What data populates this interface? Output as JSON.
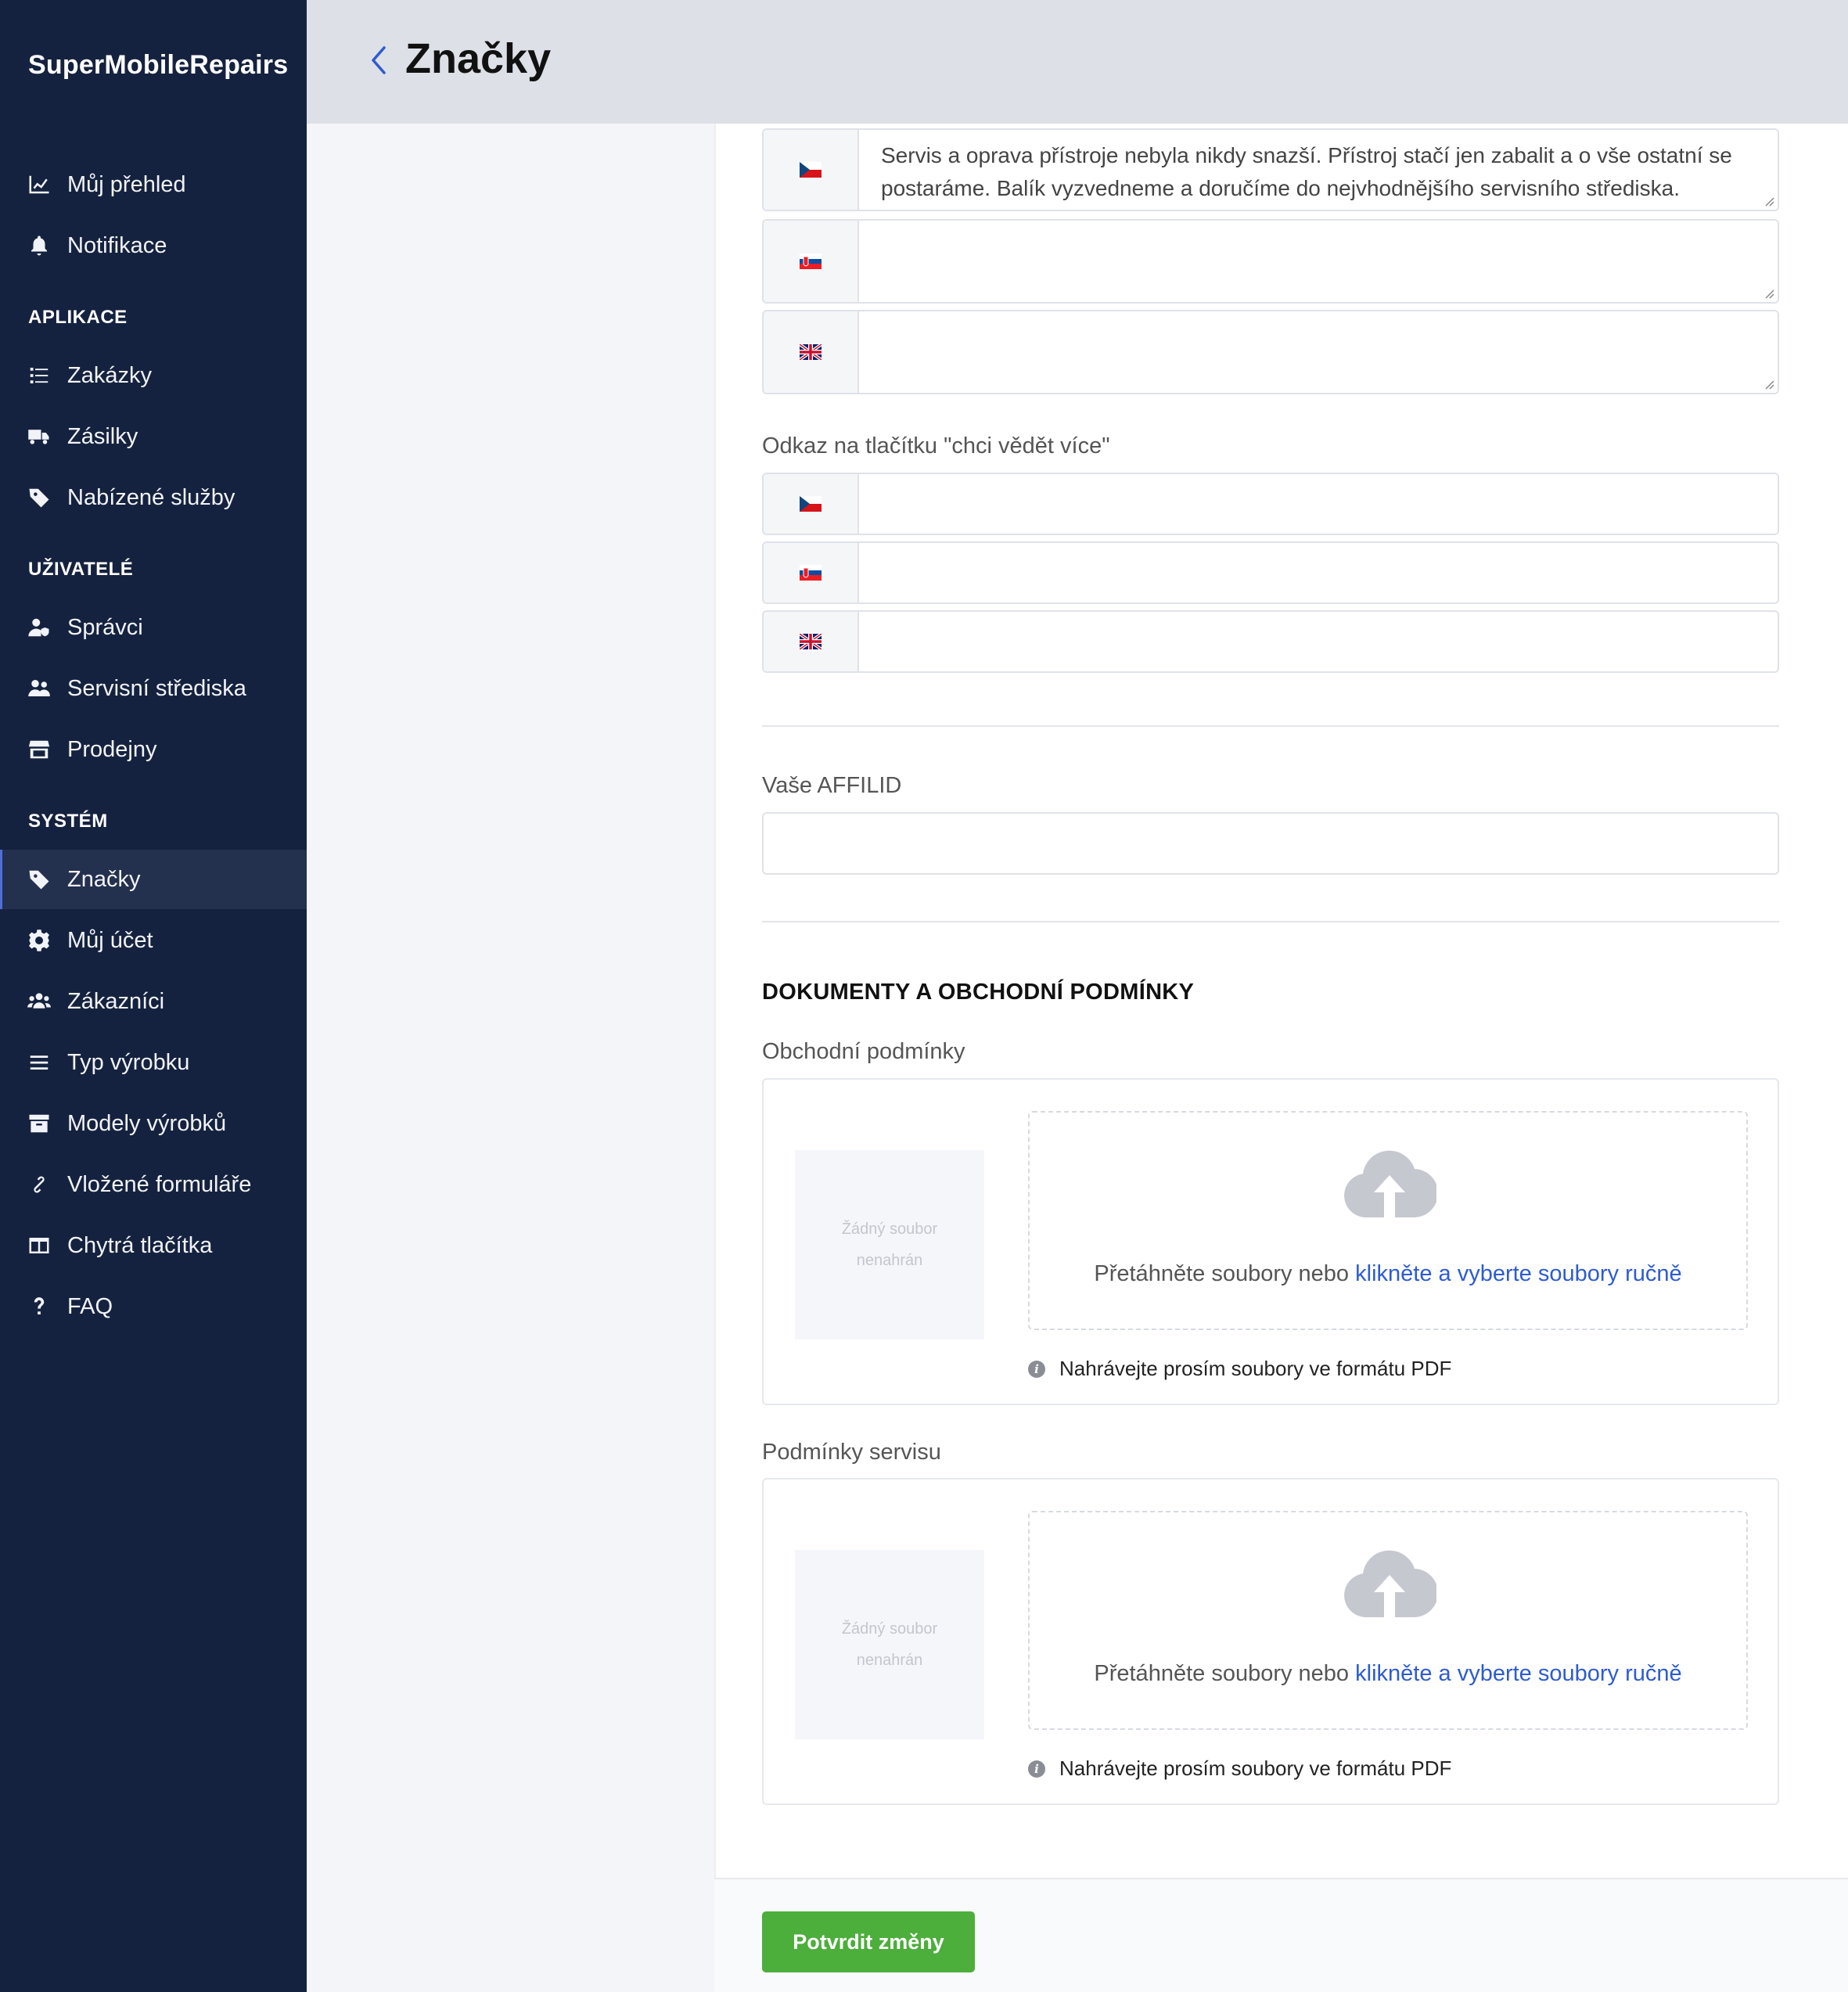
{
  "brand": "SuperMobileRepairs",
  "header": {
    "title": "Značky"
  },
  "sidebar": {
    "top_items": [
      {
        "label": "Můj přehled",
        "icon": "chart-line-icon"
      },
      {
        "label": "Notifikace",
        "icon": "bell-icon"
      }
    ],
    "sections": [
      {
        "title": "APLIKACE",
        "items": [
          {
            "label": "Zakázky",
            "icon": "list-icon"
          },
          {
            "label": "Zásilky",
            "icon": "truck-icon"
          },
          {
            "label": "Nabízené služby",
            "icon": "tag-icon"
          }
        ]
      },
      {
        "title": "UŽIVATELÉ",
        "items": [
          {
            "label": "Správci",
            "icon": "user-shield-icon"
          },
          {
            "label": "Servisní střediska",
            "icon": "users-icon"
          },
          {
            "label": "Prodejny",
            "icon": "store-icon"
          }
        ]
      },
      {
        "title": "SYSTÉM",
        "items": [
          {
            "label": "Značky",
            "icon": "tag-icon",
            "active": true
          },
          {
            "label": "Můj účet",
            "icon": "gear-icon"
          },
          {
            "label": "Zákazníci",
            "icon": "users-group-icon"
          },
          {
            "label": "Typ výrobku",
            "icon": "bars-icon"
          },
          {
            "label": "Modely výrobků",
            "icon": "archive-icon"
          },
          {
            "label": "Vložené formuláře",
            "icon": "link-icon"
          },
          {
            "label": "Chytrá tlačítka",
            "icon": "columns-icon"
          },
          {
            "label": "FAQ",
            "icon": "question-icon"
          }
        ]
      }
    ]
  },
  "form": {
    "description": {
      "cz": "Servis a oprava přístroje nebyla nikdy snazší. Přístroj stačí jen zabalit a o vše ostatní se postaráme. Balík vyzvedneme a doručíme do nejvhodnějšího servisního střediska.",
      "sk": "",
      "en": ""
    },
    "link_label": "Odkaz na tlačítku \"chci vědět více\"",
    "link": {
      "cz": "",
      "sk": "",
      "en": ""
    },
    "affil_label": "Vaše AFFILID",
    "affil_value": "",
    "docs_title": "DOKUMENTY A OBCHODNÍ PODMÍNKY",
    "uploads": [
      {
        "label": "Obchodní podmínky",
        "preview_line1": "Žádný soubor",
        "preview_line2": "nenahrán",
        "drop_text": "Přetáhněte soubory nebo ",
        "drop_link": "klikněte a vyberte soubory ručně",
        "hint": "Nahrávejte prosím soubory ve formátu PDF"
      },
      {
        "label": "Podmínky servisu",
        "preview_line1": "Žádný soubor",
        "preview_line2": "nenahrán",
        "drop_text": "Přetáhněte soubory nebo ",
        "drop_link": "klikněte a vyberte soubory ručně",
        "hint": "Nahrávejte prosím soubory ve formátu PDF"
      }
    ],
    "submit_label": "Potvrdit změny"
  },
  "colors": {
    "sidebar": "#15223f",
    "accent_link": "#2d5bd0",
    "submit": "#4cae3b"
  }
}
